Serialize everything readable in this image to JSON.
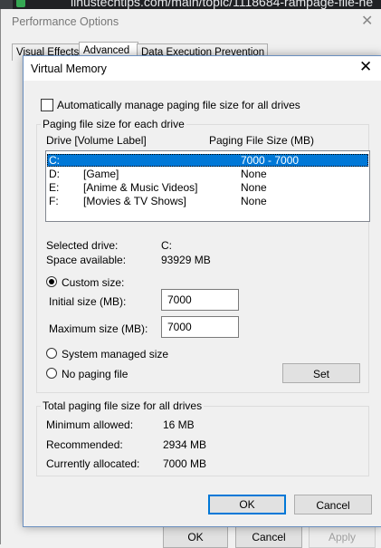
{
  "browser": {
    "url_fragment": "linustechtips.com/main/topic/1118684-rampage-file-he"
  },
  "perf_window": {
    "title": "Performance Options",
    "tabs": [
      "Visual Effects",
      "Advanced",
      "Data Execution Prevention"
    ],
    "buttons": {
      "ok": "OK",
      "cancel": "Cancel",
      "apply": "Apply"
    }
  },
  "vm": {
    "title": "Virtual Memory",
    "auto_manage_label": "Automatically manage paging file size for all drives",
    "group_label": "Paging file size for each drive",
    "col_drive": "Drive  [Volume Label]",
    "col_size": "Paging File Size (MB)",
    "drives": [
      {
        "letter": "C:",
        "label": "",
        "size": "7000 - 7000"
      },
      {
        "letter": "D:",
        "label": "[Game]",
        "size": "None"
      },
      {
        "letter": "E:",
        "label": "[Anime & Music Videos]",
        "size": "None"
      },
      {
        "letter": "F:",
        "label": "[Movies & TV Shows]",
        "size": "None"
      }
    ],
    "selected_drive_label": "Selected drive:",
    "selected_drive_value": "C:",
    "space_available_label": "Space available:",
    "space_available_value": "93929 MB",
    "custom_size_label": "Custom size:",
    "initial_size_label": "Initial size (MB):",
    "initial_size_value": "7000",
    "maximum_size_label": "Maximum size (MB):",
    "maximum_size_value": "7000",
    "system_managed_label": "System managed size",
    "no_paging_label": "No paging file",
    "set_button": "Set",
    "total_group_label": "Total paging file size for all drives",
    "minimum_allowed_label": "Minimum allowed:",
    "minimum_allowed_value": "16 MB",
    "recommended_label": "Recommended:",
    "recommended_value": "2934 MB",
    "currently_allocated_label": "Currently allocated:",
    "currently_allocated_value": "7000 MB",
    "ok_button": "OK",
    "cancel_button": "Cancel"
  }
}
